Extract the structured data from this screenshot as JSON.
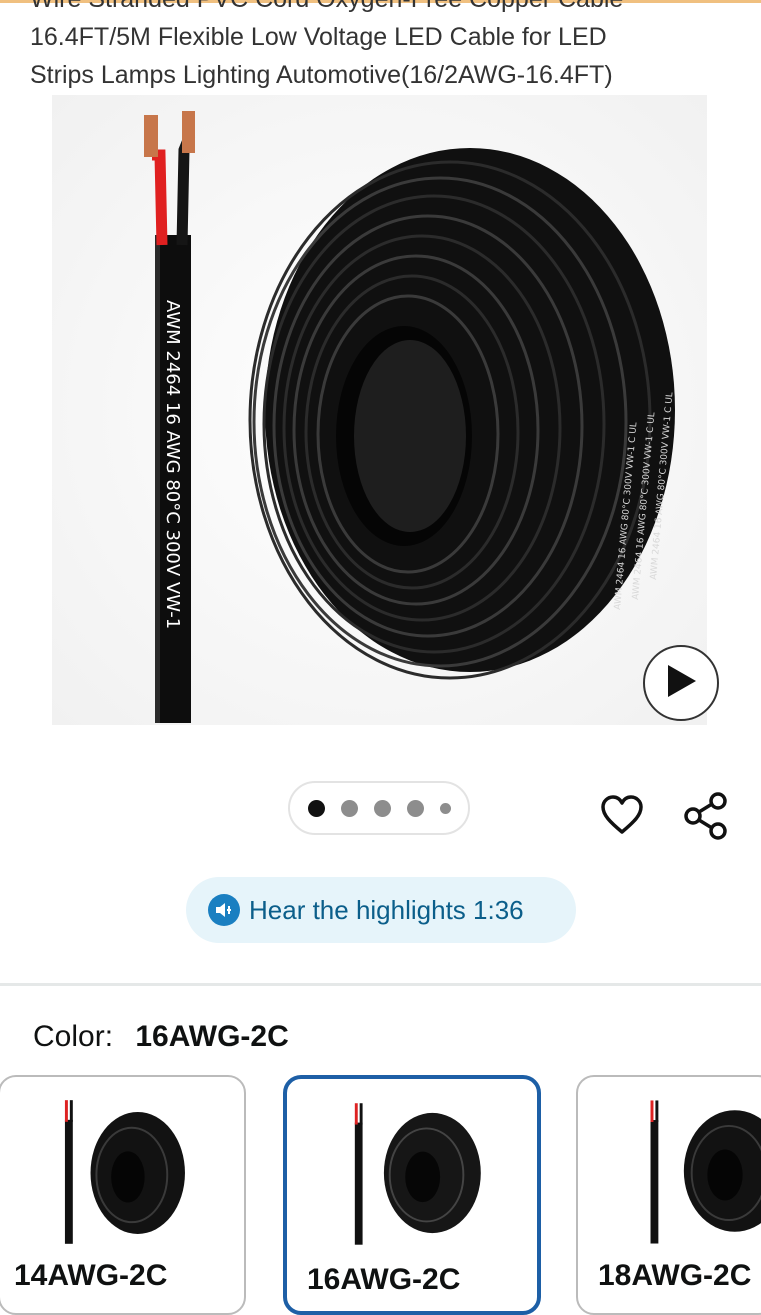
{
  "product": {
    "title_lines": [
      "Wire Stranded PVC Cord Oxygen-Free Copper Cable",
      "16.4FT/5M Flexible Low Voltage LED Cable for LED",
      "Strips Lamps Lighting Automotive(16/2AWG-16.4FT)"
    ],
    "cable_print": "AWM 2464 16 AWG 80°C 300V VW-1",
    "coil_print": "AWM 2464 16 AWG 80°C 300V VW-1 C UL"
  },
  "gallery": {
    "dot_count": 5,
    "active_index": 0
  },
  "audio": {
    "label": "Hear the highlights 1:36"
  },
  "variation": {
    "label": "Color:",
    "selected": "16AWG-2C",
    "options": [
      "14AWG-2C",
      "16AWG-2C",
      "18AWG-2C"
    ]
  },
  "colors": {
    "accent_blue": "#1d5fa6",
    "hear_bg": "#e6f4fa",
    "hear_text": "#0b5e8a"
  },
  "icons": {
    "play": "play-icon",
    "favorite": "heart-icon",
    "share": "share-icon",
    "audio": "speaker-icon"
  }
}
